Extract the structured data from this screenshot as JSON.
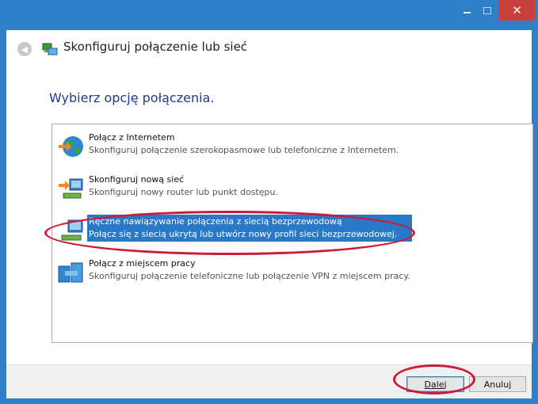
{
  "window": {
    "title": "Skonfiguruj połączenie lub sieć",
    "controls": {
      "minimize": "minimize",
      "maximize": "maximize",
      "close": "✕"
    }
  },
  "heading": "Wybierz opcję połączenia.",
  "options": [
    {
      "title": "Połącz z Internetem",
      "description": "Skonfiguruj połączenie szerokopasmowe lub telefoniczne z Internetem.",
      "icon": "globe-icon",
      "selected": false
    },
    {
      "title": "Skonfiguruj nową sieć",
      "description": "Skonfiguruj nowy router lub punkt dostępu.",
      "icon": "router-icon",
      "selected": false
    },
    {
      "title": "Ręczne nawiązywanie połączenia z siecią bezprzewodową",
      "description": "Połącz się z siecią ukrytą lub utwórz nowy profil sieci bezprzewodowej.",
      "icon": "wireless-network-icon",
      "selected": true
    },
    {
      "title": "Połącz z miejscem pracy",
      "description": "Skonfiguruj połączenie telefoniczne lub połączenie VPN z miejscem pracy.",
      "icon": "workplace-icon",
      "selected": false
    }
  ],
  "buttons": {
    "next": "Dalej",
    "cancel": "Anuluj"
  },
  "colors": {
    "titlebar": "#2f7fc9",
    "close": "#c7413a",
    "selection": "#2a78c8",
    "heading": "#1e3b8d",
    "annotation": "#cc1b3a"
  }
}
